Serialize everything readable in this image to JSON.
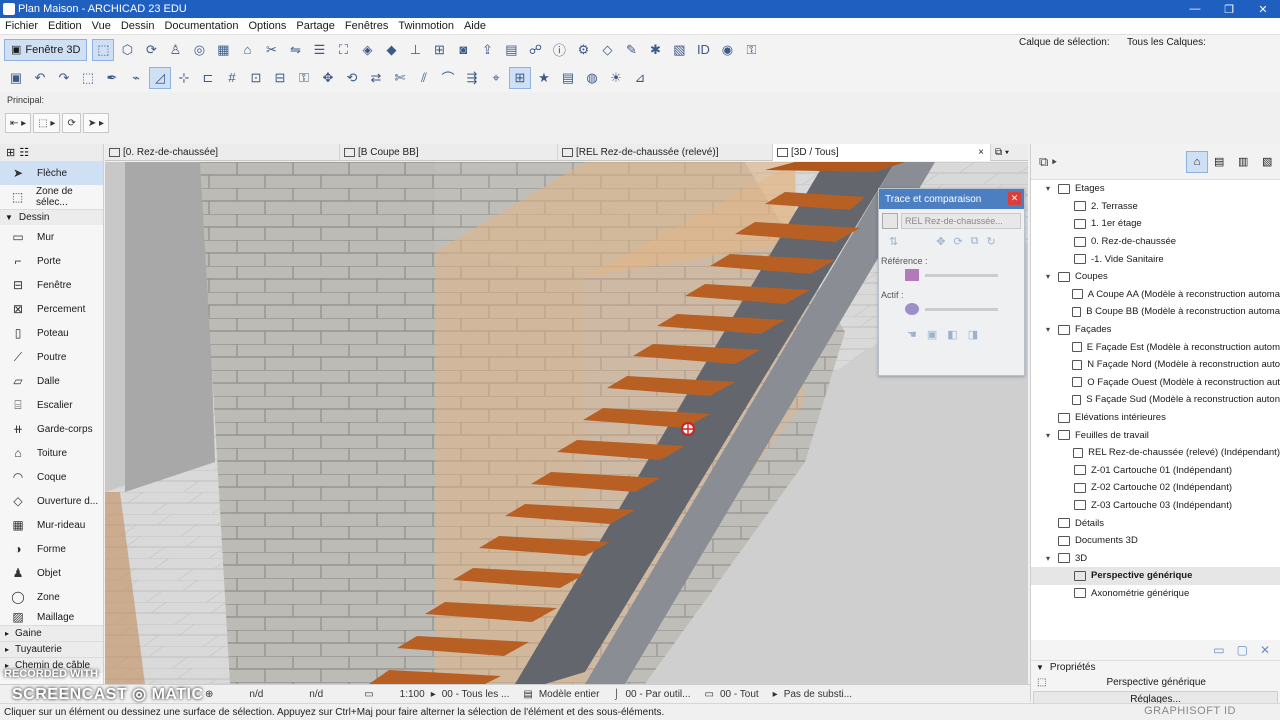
{
  "window": {
    "title": "Plan Maison - ARCHICAD 23 EDU",
    "minimize": "—",
    "restore": "❐",
    "close": "✕"
  },
  "menu": [
    "Fichier",
    "Edition",
    "Vue",
    "Dessin",
    "Documentation",
    "Options",
    "Partage",
    "Fenêtres",
    "Twinmotion",
    "Aide"
  ],
  "toolbar": {
    "fenetre3d": "Fenêtre 3D",
    "calque_selection_label": "Calque de sélection:",
    "tous_calques_label": "Tous les Calques:",
    "principal": "Principal:"
  },
  "tabs": [
    {
      "label": "[0. Rez-de-chaussée]"
    },
    {
      "label": "[B Coupe BB]"
    },
    {
      "label": "[REL Rez-de-chaussée (relevé)]"
    },
    {
      "label": "[3D / Tous]",
      "close": "×"
    }
  ],
  "toolbox": {
    "arrow": "Flèche",
    "marquee": "Zone de sélec...",
    "dessin_header": "Dessin",
    "tools": [
      "Mur",
      "Porte",
      "Fenêtre",
      "Percement",
      "Poteau",
      "Poutre",
      "Dalle",
      "Escalier",
      "Garde-corps",
      "Toiture",
      "Coque",
      "Ouverture d...",
      "Mur-rideau",
      "Forme",
      "Objet",
      "Zone",
      "Maillage"
    ],
    "sections": [
      "Gaine",
      "Tuyauterie",
      "Chemin de câble"
    ]
  },
  "trace": {
    "title": "Trace et comparaison",
    "ref_field": "REL Rez-de-chaussée...",
    "reference_label": "Référence :",
    "actif_label": "Actif :"
  },
  "navigator": {
    "rows": [
      {
        "level": 1,
        "exp": "▾",
        "label": "Etages",
        "icon": "folder"
      },
      {
        "level": 2,
        "label": "2. Terrasse"
      },
      {
        "level": 2,
        "label": "1. 1er étage"
      },
      {
        "level": 2,
        "label": "0. Rez-de-chaussée"
      },
      {
        "level": 2,
        "label": "-1. Vide Sanitaire"
      },
      {
        "level": 1,
        "exp": "▾",
        "label": "Coupes",
        "icon": "folder"
      },
      {
        "level": 2,
        "label": "A Coupe AA (Modèle à reconstruction automa"
      },
      {
        "level": 2,
        "label": "B Coupe BB (Modèle à reconstruction automa"
      },
      {
        "level": 1,
        "exp": "▾",
        "label": "Façades",
        "icon": "folder"
      },
      {
        "level": 2,
        "label": "E Façade Est (Modèle à reconstruction autom"
      },
      {
        "level": 2,
        "label": "N Façade Nord (Modèle à reconstruction auto"
      },
      {
        "level": 2,
        "label": "O Façade Ouest (Modèle à reconstruction aut"
      },
      {
        "level": 2,
        "label": "S Façade Sud (Modèle à reconstruction auton"
      },
      {
        "level": 1,
        "label": "Elévations intérieures"
      },
      {
        "level": 1,
        "exp": "▾",
        "label": "Feuilles de travail"
      },
      {
        "level": 2,
        "label": "REL Rez-de-chaussée (relevé) (Indépendant)"
      },
      {
        "level": 2,
        "label": "Z-01 Cartouche 01 (Indépendant)"
      },
      {
        "level": 2,
        "label": "Z-02 Cartouche 02 (Indépendant)"
      },
      {
        "level": 2,
        "label": "Z-03 Cartouche 03 (Indépendant)"
      },
      {
        "level": 1,
        "label": "Détails"
      },
      {
        "level": 1,
        "label": "Documents 3D"
      },
      {
        "level": 1,
        "exp": "▾",
        "label": "3D"
      },
      {
        "level": 2,
        "label": "Perspective générique",
        "selected": true
      },
      {
        "level": 2,
        "label": "Axonométrie générique"
      }
    ]
  },
  "properties": {
    "header": "Propriétés",
    "name": "Perspective générique",
    "settings": "Réglages..."
  },
  "statusnav": {
    "nd1": "n/d",
    "nd2": "n/d",
    "scale": "1:100",
    "layers": "00 - Tous les ...",
    "model": "Modèle entier",
    "pen": "00 - Par outil...",
    "dim": "00 - Tout",
    "subst": "Pas de substi..."
  },
  "status": "Cliquer sur un élément ou dessinez une surface de sélection. Appuyez sur Ctrl+Maj pour faire alterner la sélection de l'élément et des sous-éléments.",
  "watermark": {
    "line1": "RECORDED WITH",
    "line2": "SCREENCAST ◎ MATIC"
  },
  "brand": "GRAPHISOFT ID"
}
